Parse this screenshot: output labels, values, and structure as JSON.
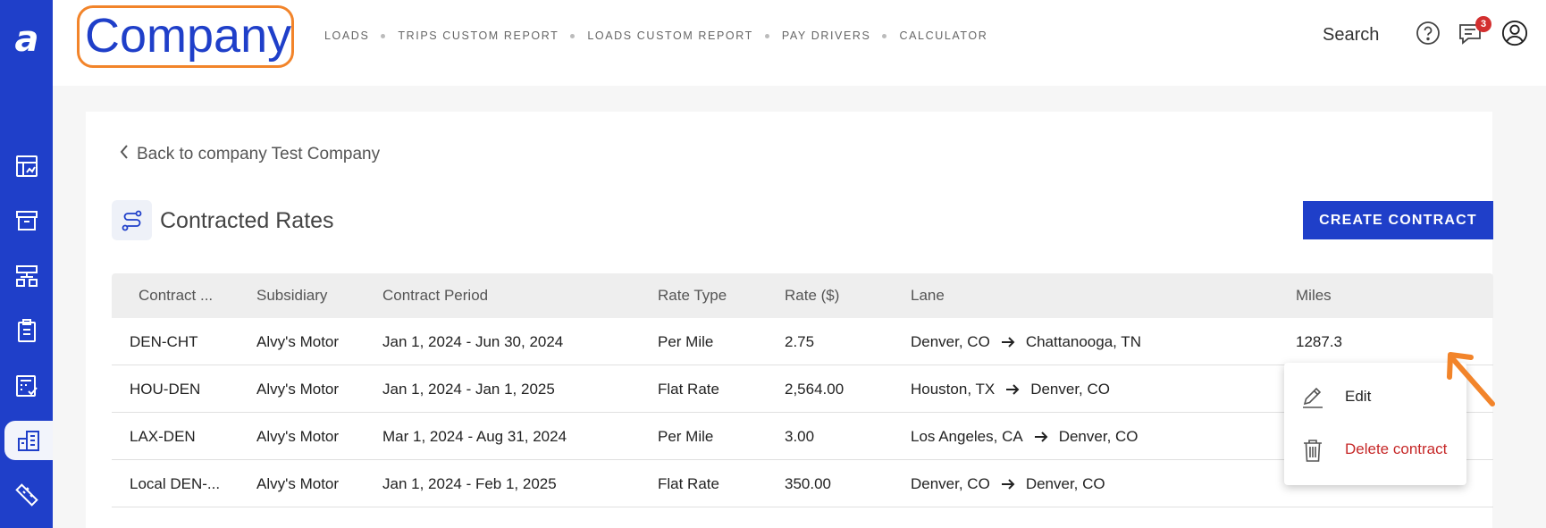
{
  "app": {
    "logo_letter": "a",
    "company_name": "Company"
  },
  "nav": {
    "items": [
      "LOADS",
      "TRIPS CUSTOM REPORT",
      "LOADS CUSTOM REPORT",
      "PAY DRIVERS",
      "CALCULATOR"
    ]
  },
  "header": {
    "search_label": "Search",
    "notification_count": "3"
  },
  "sidebar": {
    "icons": [
      "dashboard-icon",
      "archive-icon",
      "org-chart-icon",
      "clipboard-icon",
      "calculator-icon",
      "company-buildings-icon",
      "ruler-icon"
    ],
    "active": "company-buildings-icon"
  },
  "page": {
    "back_link": "Back to company Test Company",
    "title": "Contracted Rates",
    "create_button": "CREATE CONTRACT"
  },
  "table": {
    "columns": [
      "Contract ...",
      "Subsidiary",
      "Contract Period",
      "Rate Type",
      "Rate ($)",
      "Lane",
      "Miles"
    ],
    "rows": [
      {
        "contract": "DEN-CHT",
        "subsidiary": "Alvy's Motor",
        "period": "Jan 1, 2024 - Jun 30, 2024",
        "rate_type": "Per Mile",
        "rate": "2.75",
        "origin": "Denver, CO",
        "destination": "Chattanooga, TN",
        "miles": "1287.3"
      },
      {
        "contract": "HOU-DEN",
        "subsidiary": "Alvy's Motor",
        "period": "Jan 1, 2024 - Jan 1, 2025",
        "rate_type": "Flat Rate",
        "rate": "2,564.00",
        "origin": "Houston, TX",
        "destination": "Denver, CO",
        "miles": ""
      },
      {
        "contract": "LAX-DEN",
        "subsidiary": "Alvy's Motor",
        "period": "Mar 1, 2024 - Aug 31, 2024",
        "rate_type": "Per Mile",
        "rate": "3.00",
        "origin": "Los Angeles, CA",
        "destination": "Denver, CO",
        "miles": ""
      },
      {
        "contract": "Local DEN-...",
        "subsidiary": "Alvy's Motor",
        "period": "Jan 1, 2024 - Feb 1, 2025",
        "rate_type": "Flat Rate",
        "rate": "350.00",
        "origin": "Denver, CO",
        "destination": "Denver, CO",
        "miles": ""
      }
    ]
  },
  "context_menu": {
    "edit": "Edit",
    "delete": "Delete contract"
  },
  "colors": {
    "brand": "#1f3fc9",
    "highlight": "#f2842a",
    "danger": "#c62828"
  }
}
